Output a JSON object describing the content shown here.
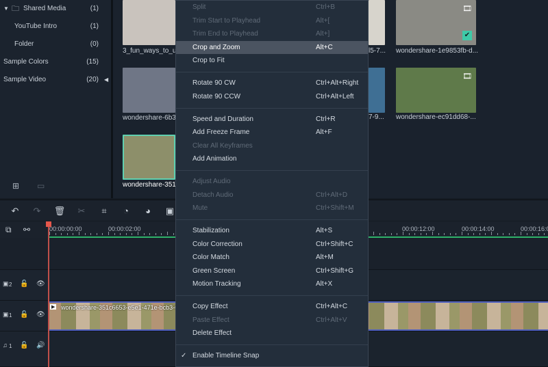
{
  "library": {
    "items": [
      {
        "label": "Shared Media",
        "count": "(1)",
        "level": 0,
        "expanded": true
      },
      {
        "label": "YouTube Intro",
        "count": "(1)",
        "level": 1
      },
      {
        "label": "Folder",
        "count": "(0)",
        "level": 1
      },
      {
        "label": "Sample Colors",
        "count": "(15)",
        "level": -1
      },
      {
        "label": "Sample Video",
        "count": "(20)",
        "level": -1
      }
    ]
  },
  "media": {
    "items": [
      {
        "label": "3_fun_ways_to_us",
        "color": "#c9c3bd"
      },
      {
        "label": "wondershare-6b3!",
        "color": "#6f7686"
      },
      {
        "label": "wondershare-351c",
        "color": "#8d8f6a",
        "selected": true
      },
      {
        "label": "l5-7...",
        "color": "#d7d4cc"
      },
      {
        "label": "7-9...",
        "color": "#3f6f94"
      },
      {
        "label": "wondershare-1e9853fb-d...",
        "color": "#8a8a84",
        "checked": true
      },
      {
        "label": "wondershare-ec91dd68-...",
        "color": "#5f7a4a"
      }
    ]
  },
  "timeline": {
    "ticks": [
      "00:00:00:00",
      "00:00:02:00",
      "00:00:12:00",
      "00:00:14:00",
      "00:00:16:0"
    ],
    "tracks": [
      {
        "label": "2"
      },
      {
        "label": "1"
      },
      {
        "label": "1"
      }
    ],
    "clip_label": "wondershare-351c6653-e5e1-471e-bcb3-622 9e"
  },
  "menu": {
    "groups": [
      [
        {
          "label": "Split",
          "shortcut": "Ctrl+B",
          "disabled": true
        },
        {
          "label": "Trim Start to Playhead",
          "shortcut": "Alt+[",
          "disabled": true
        },
        {
          "label": "Trim End to Playhead",
          "shortcut": "Alt+]",
          "disabled": true
        },
        {
          "label": "Crop and Zoom",
          "shortcut": "Alt+C",
          "highlighted": true
        },
        {
          "label": "Crop to Fit",
          "shortcut": ""
        }
      ],
      [
        {
          "label": "Rotate 90 CW",
          "shortcut": "Ctrl+Alt+Right"
        },
        {
          "label": "Rotate 90 CCW",
          "shortcut": "Ctrl+Alt+Left"
        }
      ],
      [
        {
          "label": "Speed and Duration",
          "shortcut": "Ctrl+R"
        },
        {
          "label": "Add Freeze Frame",
          "shortcut": "Alt+F"
        },
        {
          "label": "Clear All Keyframes",
          "shortcut": "",
          "disabled": true
        },
        {
          "label": "Add Animation",
          "shortcut": ""
        }
      ],
      [
        {
          "label": "Adjust Audio",
          "shortcut": "",
          "disabled": true
        },
        {
          "label": "Detach Audio",
          "shortcut": "Ctrl+Alt+D",
          "disabled": true
        },
        {
          "label": "Mute",
          "shortcut": "Ctrl+Shift+M",
          "disabled": true
        }
      ],
      [
        {
          "label": "Stabilization",
          "shortcut": "Alt+S"
        },
        {
          "label": "Color Correction",
          "shortcut": "Ctrl+Shift+C"
        },
        {
          "label": "Color Match",
          "shortcut": "Alt+M"
        },
        {
          "label": "Green Screen",
          "shortcut": "Ctrl+Shift+G"
        },
        {
          "label": "Motion Tracking",
          "shortcut": "Alt+X"
        }
      ],
      [
        {
          "label": "Copy Effect",
          "shortcut": "Ctrl+Alt+C"
        },
        {
          "label": "Paste Effect",
          "shortcut": "Ctrl+Alt+V",
          "disabled": true
        },
        {
          "label": "Delete Effect",
          "shortcut": ""
        }
      ],
      [
        {
          "label": "Enable Timeline Snap",
          "shortcut": "",
          "checked": true
        }
      ]
    ]
  },
  "colors": {
    "accent": "#2fb36a",
    "playhead": "#e5574b",
    "selection": "#5fd0b0",
    "clip_border": "#4f5fbf"
  }
}
